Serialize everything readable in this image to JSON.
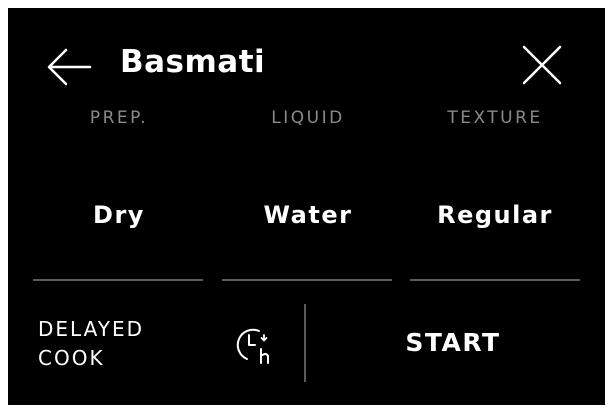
{
  "header": {
    "back_icon": "arrow-left-icon",
    "title": "Basmati",
    "close_icon": "close-icon"
  },
  "settings": [
    {
      "category": "PREP.",
      "value": "Dry"
    },
    {
      "category": "LIQUID",
      "value": "Water"
    },
    {
      "category": "TEXTURE",
      "value": "Regular"
    }
  ],
  "footer": {
    "delayed_line1": "DELAYED",
    "delayed_line2": "COOK",
    "timer_icon": "delay-timer-icon",
    "start_label": "START"
  },
  "colors": {
    "background": "#000000",
    "text": "#ffffff",
    "muted_text": "#8a8a8a",
    "divider": "#5a5a5a"
  }
}
